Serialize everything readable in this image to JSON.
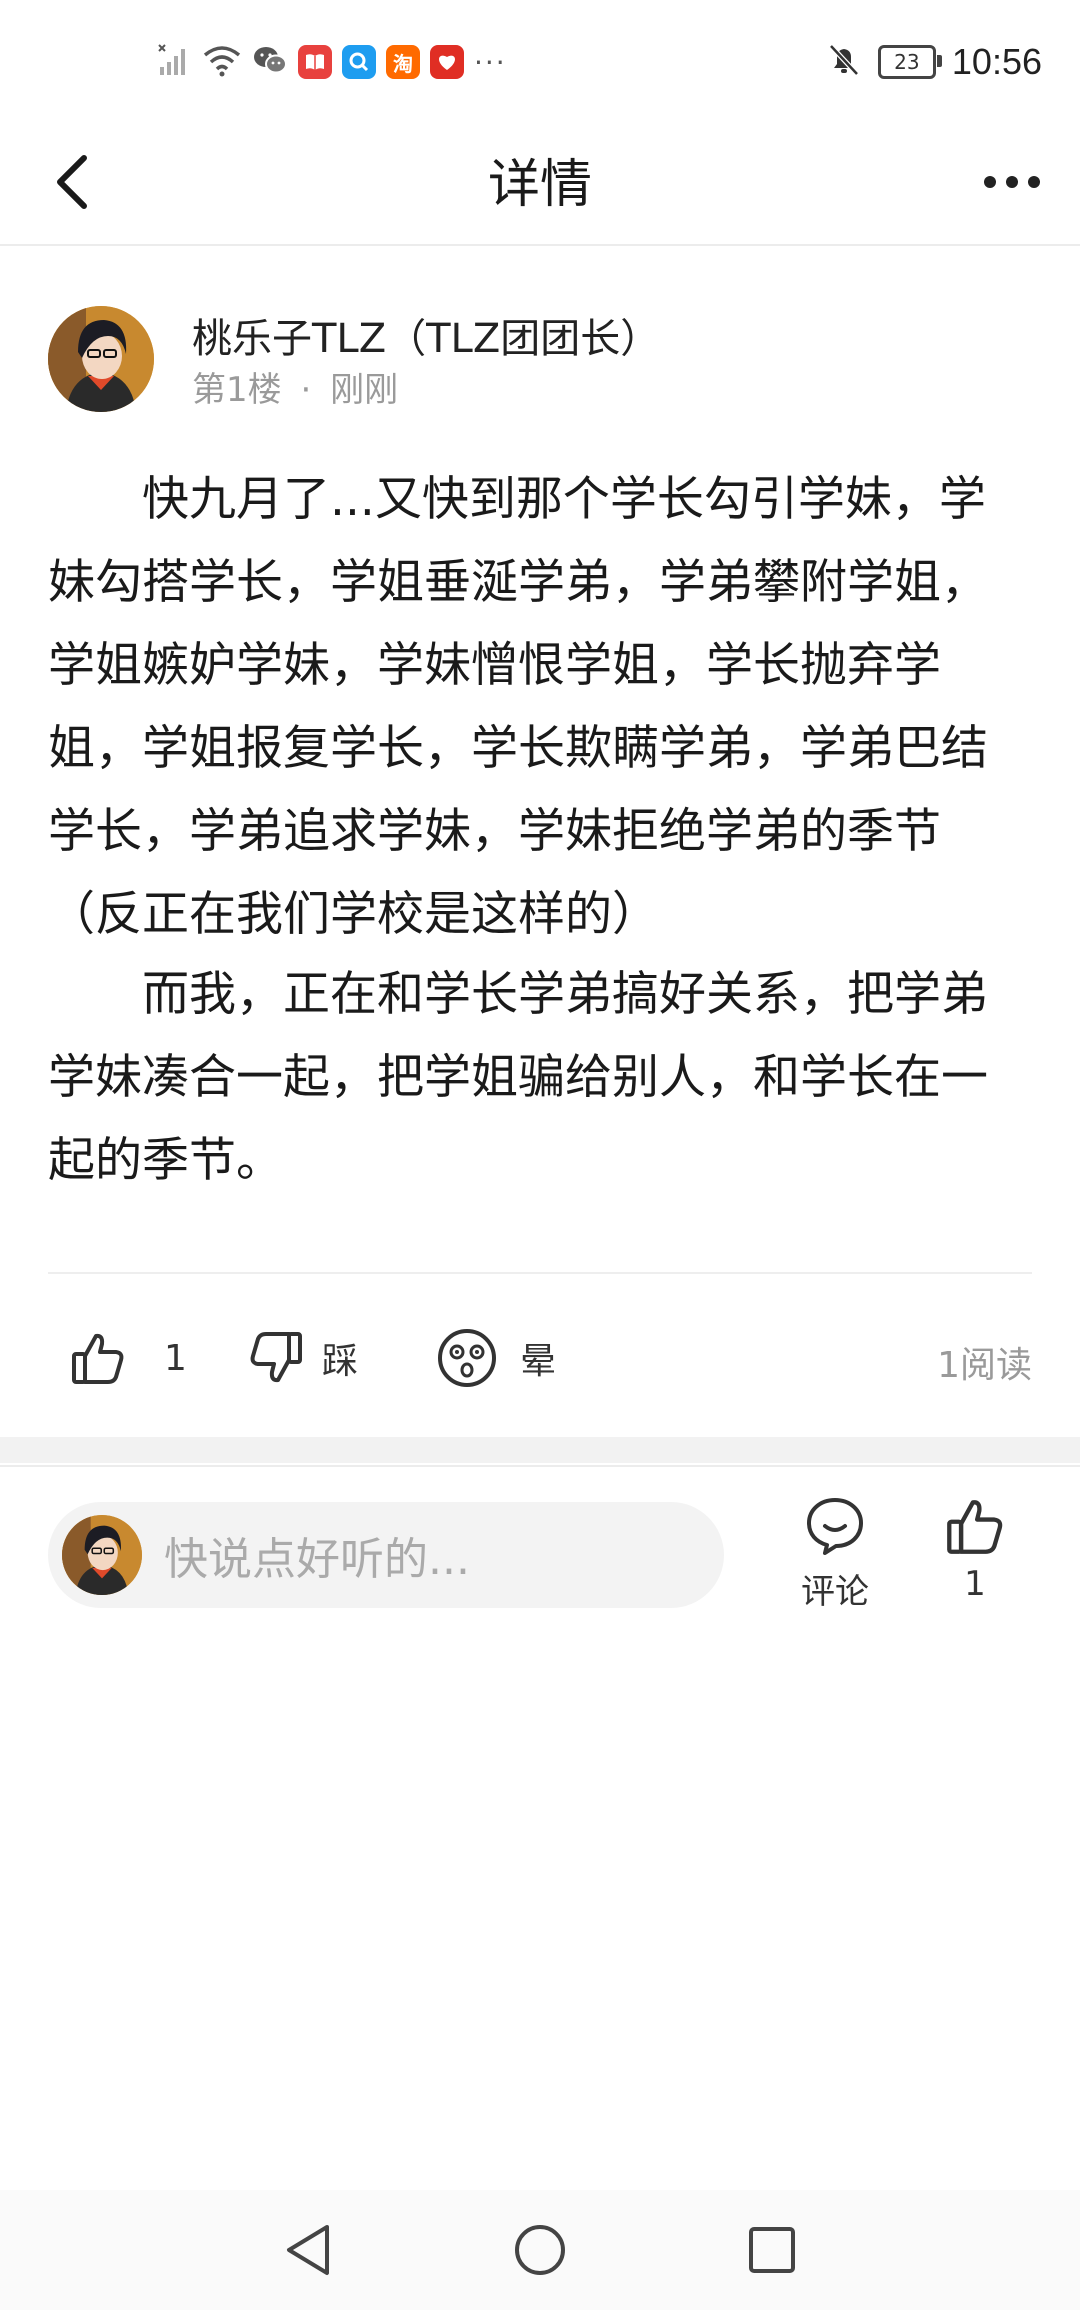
{
  "status_bar": {
    "time": "10:56",
    "battery_level": "23",
    "more_indicator": "···",
    "notification_icons": [
      {
        "name": "signal-icon",
        "glyph": ""
      },
      {
        "name": "wifi-icon",
        "glyph": ""
      },
      {
        "name": "wechat-icon",
        "glyph": ""
      },
      {
        "name": "reader-app-icon",
        "glyph": "",
        "color": "#e8413e"
      },
      {
        "name": "search-app-icon",
        "glyph": "",
        "color": "#1e9df0"
      },
      {
        "name": "taobao-app-icon",
        "glyph": "淘",
        "color": "#ff6a00"
      },
      {
        "name": "pinduoduo-app-icon",
        "glyph": "",
        "color": "#e02e24"
      }
    ],
    "silent_icon": "bell-off-icon"
  },
  "nav": {
    "title": "详情",
    "back_icon": "chevron-left-icon",
    "more_icon": "more-dots-icon"
  },
  "post": {
    "author": "桃乐子TLZ（TLZ团团长）",
    "floor": "第1楼",
    "separator": "·",
    "time": "刚刚",
    "paragraphs": [
      "快九月了...又快到那个学长勾引学妹，学妹勾搭学长，学姐垂涎学弟，学弟攀附学姐，学姐嫉妒学妹，学妹憎恨学姐，学长抛弃学姐，学姐报复学长，学长欺瞒学弟，学弟巴结学长，学弟追求学妹，学妹拒绝学弟的季节（反正在我们学校是这样的）",
      "而我，正在和学长学弟搞好关系，把学弟学妹凑合一起，把学姐骗给别人，和学长在一起的季节。"
    ]
  },
  "actions": {
    "like_count": "1",
    "dislike_label": "踩",
    "dizzy_label": "晕",
    "read_count": "1阅读"
  },
  "comment_bar": {
    "placeholder": "快说点好听的...",
    "comment_label": "评论",
    "like_count": "1"
  },
  "colors": {
    "accent_text": "#222222",
    "meta_text": "#9a9a9a",
    "avatar_bg": "#d8a13a"
  }
}
